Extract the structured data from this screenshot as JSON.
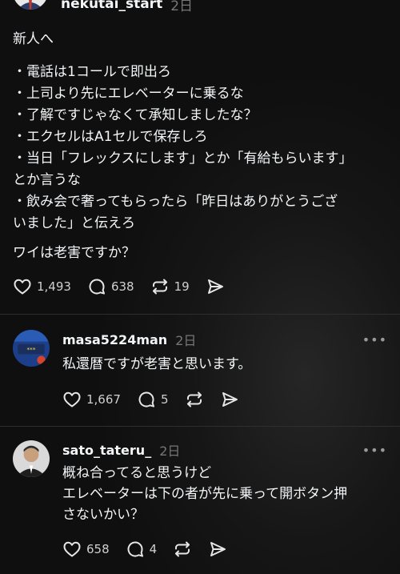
{
  "top_post": {
    "username": "nekutai_start",
    "time": "2日",
    "lines": [
      "新人へ",
      "",
      "・電話は1コールで即出ろ",
      "・上司より先にエレベーターに乗るな",
      "・了解ですじゃなくて承知しましたな？",
      "・エクセルはA1セルで保存しろ",
      "・当日「フレックスにします」とか「有給もらいます」",
      "とか言うな",
      "・飲み会で奢ってもらったら「昨日はありがとうござ",
      "いました」と伝えろ",
      "",
      "ワイは老害ですか？"
    ],
    "like_count": "1,493",
    "reply_count": "638",
    "repost_count": "19"
  },
  "replies": [
    {
      "username": "masa5224man",
      "time": "2日",
      "lines": [
        "私還暦ですが老害と思います。"
      ],
      "like_count": "1,667",
      "reply_count": "5"
    },
    {
      "username": "sato_tateru_",
      "time": "2日",
      "lines": [
        "概ね合ってると思うけど",
        "エレベーターは下の者が先に乗って開ボタン押",
        "さないかい？"
      ],
      "like_count": "658",
      "reply_count": "4"
    }
  ],
  "icons": [
    "heart-icon",
    "comment-icon",
    "repost-icon",
    "share-icon",
    "more-icon"
  ],
  "colors": {
    "background": "#101010",
    "text": "#f3f5f7",
    "muted": "#777777"
  }
}
